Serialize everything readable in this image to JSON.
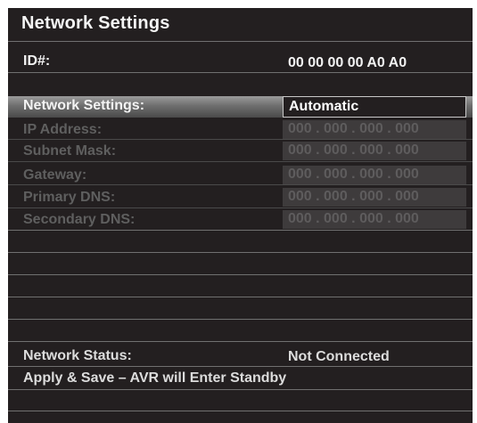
{
  "screen": {
    "title": "Network Settings",
    "id_label": "ID#:",
    "id_value": "00 00 00 00 A0 A0",
    "network_settings_label": "Network Settings:",
    "network_settings_value": "Automatic",
    "fields": [
      {
        "label": "IP Address:",
        "value": "000 . 000 . 000 . 000"
      },
      {
        "label": "Subnet Mask:",
        "value": "000 . 000 . 000 . 000"
      },
      {
        "label": "Gateway:",
        "value": "000 . 000 . 000 . 000"
      },
      {
        "label": "Primary DNS:",
        "value": "000 . 000 . 000 . 000"
      },
      {
        "label": "Secondary DNS:",
        "value": "000 . 000 . 000 . 000"
      }
    ],
    "network_status_label": "Network Status:",
    "network_status_value": "Not Connected",
    "apply_label": "Apply & Save – AVR will Enter Standby"
  },
  "colors": {
    "background": "#231f20",
    "text": "#f3f3f3",
    "disabled_text": "#5f5f5f",
    "field_box": "#3e3b3c",
    "highlight": "#9b9b9b"
  }
}
